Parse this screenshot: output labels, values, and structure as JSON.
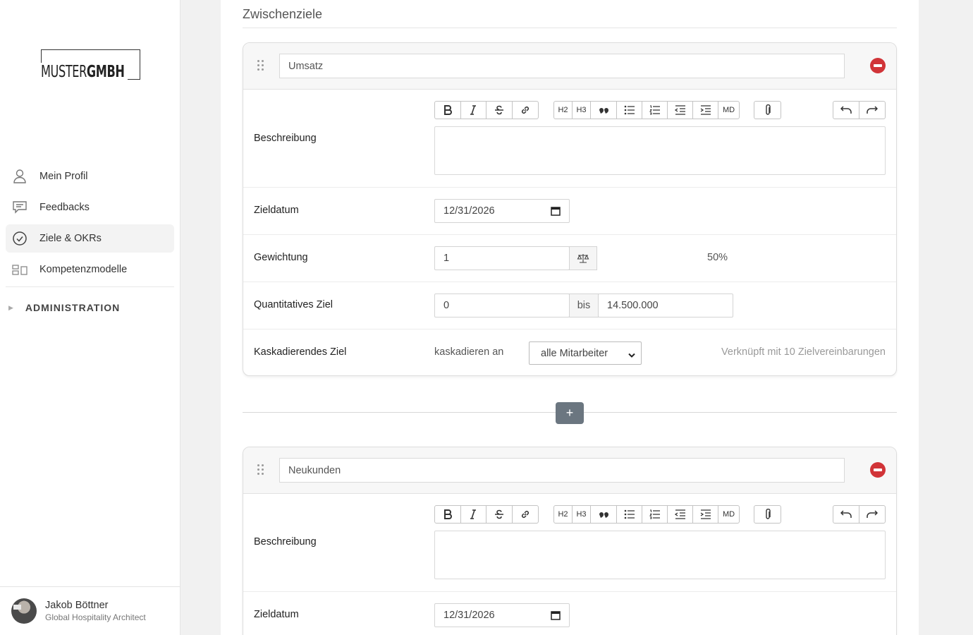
{
  "brand": {
    "logo_text_a": "MUSTER",
    "logo_text_b": "GMBH"
  },
  "sidebar": {
    "items": [
      {
        "label": "Mein Profil",
        "icon": "user-icon",
        "active": false
      },
      {
        "label": "Feedbacks",
        "icon": "chat-icon",
        "active": false
      },
      {
        "label": "Ziele & OKRs",
        "icon": "check-circle-icon",
        "active": true
      },
      {
        "label": "Kompetenzmodelle",
        "icon": "model-icon",
        "active": false
      }
    ],
    "admin_label": "ADMINISTRATION",
    "user": {
      "name": "Jakob Böttner",
      "role": "Global Hospitality Architect"
    }
  },
  "main": {
    "section_title": "Zwischenziele",
    "add_button_label": "+",
    "toolbar": {
      "heading2": "H2",
      "heading3": "H3",
      "markdown": "MD"
    },
    "goals": [
      {
        "title": "Umsatz",
        "labels": {
          "description": "Beschreibung",
          "due_date": "Zieldatum",
          "weight": "Gewichtung",
          "quantitative": "Quantitatives Ziel",
          "cascading": "Kaskadierendes Ziel"
        },
        "due_date": "12/31/2026",
        "weight": "1",
        "weight_percent": "50%",
        "quant_from": "0",
        "quant_to_label": "bis",
        "quant_to": "14.500.000",
        "cascade_label": "kaskadieren an",
        "cascade_select": "alle Mitarbeiter",
        "linked_text": "Verknüpft mit 10 Zielvereinbarungen"
      },
      {
        "title": "Neukunden",
        "labels": {
          "description": "Beschreibung",
          "due_date": "Zieldatum"
        },
        "due_date": "12/31/2026"
      }
    ]
  }
}
